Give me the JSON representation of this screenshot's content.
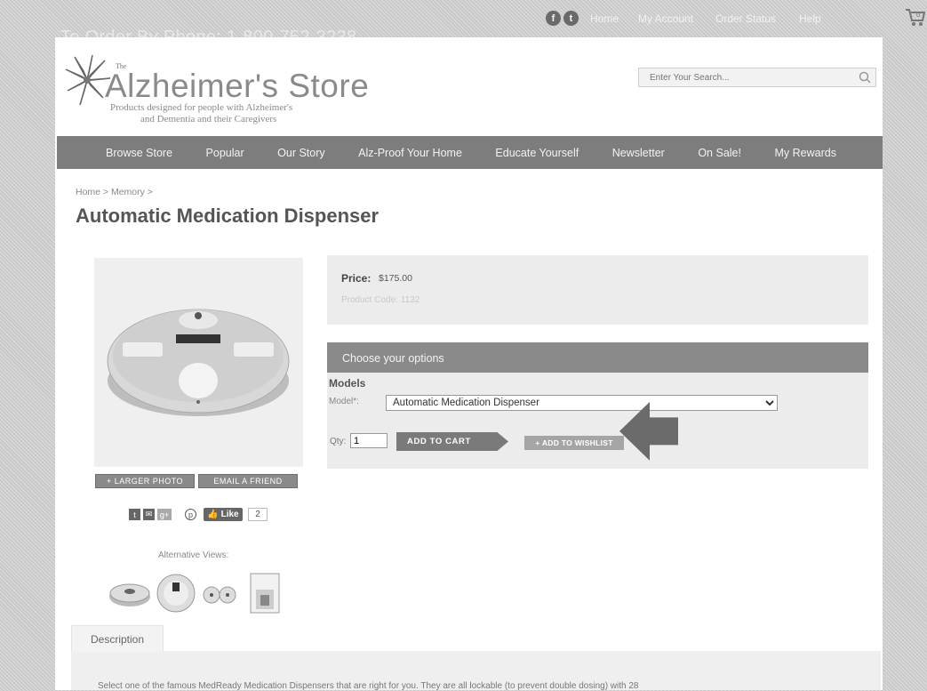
{
  "topbar": {
    "phone": "To Order By Phone: 1-800-752-3238",
    "social": [
      {
        "icon": "facebook-icon",
        "glyph": "f"
      },
      {
        "icon": "twitter-icon",
        "glyph": "t"
      }
    ],
    "links": [
      "Home",
      "My Account",
      "Order Status",
      "Help"
    ],
    "cart_count": "0"
  },
  "logo": {
    "the": "The",
    "name": "Alzheimer's Store",
    "tagline_1": "Products designed for people with Alzheimer's",
    "tagline_2": "and Dementia and their Caregivers"
  },
  "search": {
    "placeholder": "Enter Your Search..."
  },
  "nav": [
    "Browse Store",
    "Popular",
    "Our Story",
    "Alz-Proof Your Home",
    "Educate Yourself",
    "Newsletter",
    "On Sale!",
    "My Rewards"
  ],
  "breadcrumb": "Home > Memory >",
  "product": {
    "title": "Automatic Medication Dispenser",
    "price_label": "Price:",
    "price": "$175.00",
    "code": "Product Code: 1132",
    "larger_photo": "+ LARGER PHOTO",
    "email_friend": "EMAIL A FRIEND",
    "like_label": "Like",
    "like_count": "2",
    "alt_views_label": "Alternative Views:"
  },
  "options": {
    "title": "Choose your options",
    "models_label": "Models",
    "model_label": "Model*:",
    "model_selected": "Automatic Medication Dispenser",
    "qty_label": "Qty:",
    "qty_value": "1",
    "add_to_cart": "ADD TO CART",
    "add_to_wishlist": "+ ADD TO WISHLIST"
  },
  "description": {
    "tab": "Description",
    "text": "Select one of the famous MedReady Medication Dispensers that are right for you. They are all lockable (to prevent double dosing) with 28"
  },
  "colors": {
    "nav_bg": "#7d7d7d",
    "page_bg": "#ffffff",
    "panel_bg": "#ececec"
  }
}
